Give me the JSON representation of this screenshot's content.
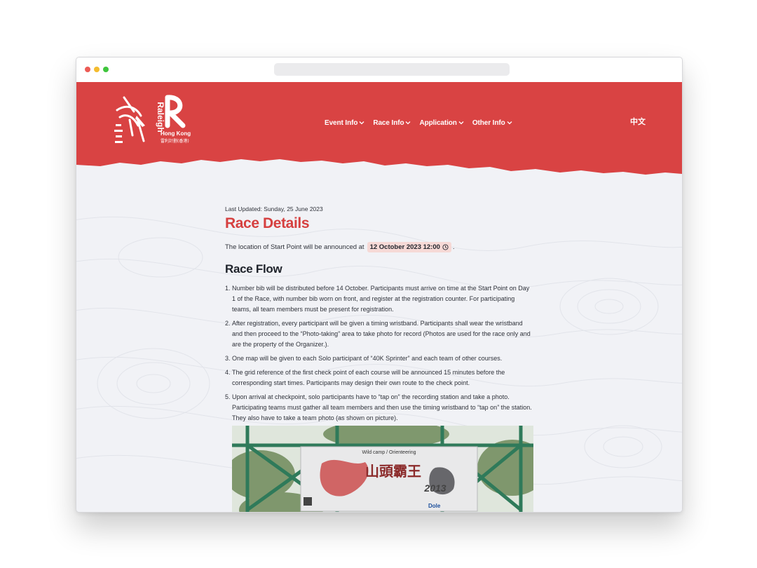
{
  "nav": {
    "items": [
      {
        "label": "Event Info"
      },
      {
        "label": "Race Info"
      },
      {
        "label": "Application"
      },
      {
        "label": "Other Info"
      }
    ],
    "lang": "中文"
  },
  "logo": {
    "org": "Raleigh",
    "region": "Hong Kong",
    "chinese": "雷利計劃(香港)",
    "event_chinese": "山頭霸王"
  },
  "content": {
    "last_updated": "Last Updated: Sunday, 25 June 2023",
    "title": "Race Details",
    "announce_text": "The location of Start Point will be announced at",
    "announce_date": "12 October 2023 12:00",
    "announce_end": ".",
    "section_title": "Race Flow",
    "steps": [
      {
        "num": "1.",
        "text": "Number bib will be distributed before 14 October. Participants must arrive on time at the Start Point on Day 1 of the Race, with number bib worn on front, and register at the registration counter. For participating teams, all team members must be present for registration."
      },
      {
        "num": "2.",
        "text": "After registration, every participant will be given a timing wristband. Participants shall wear the wristband and then proceed to the “Photo-taking” area to take photo for record (Photos are used for the race only and are the property of the Organizer.)."
      },
      {
        "num": "3.",
        "text": "One map will be given to each Solo participant of “40K Sprinter” and each team of other courses."
      },
      {
        "num": "4.",
        "text": "The grid reference of the first check point of each course will be announced 15 minutes before the corresponding start times. Participants may design their own route to the check point."
      },
      {
        "num": "5.",
        "text": "Upon arrival at checkpoint, solo participants have to “tap on” the recording station and take a photo. Participating teams must gather all team members and then use the timing wristband to “tap on” the station. They also have to take a team photo (as shown on picture)."
      }
    ]
  },
  "photo": {
    "banner_top": "Wild camp / Orienteering",
    "banner_chinese": "山頭霸王",
    "banner_year": "2013",
    "sponsor_1": "Dole"
  },
  "colors": {
    "brand_red": "#d94343",
    "page_bg": "#f1f2f6",
    "chip_bg": "#f6d9d6"
  }
}
